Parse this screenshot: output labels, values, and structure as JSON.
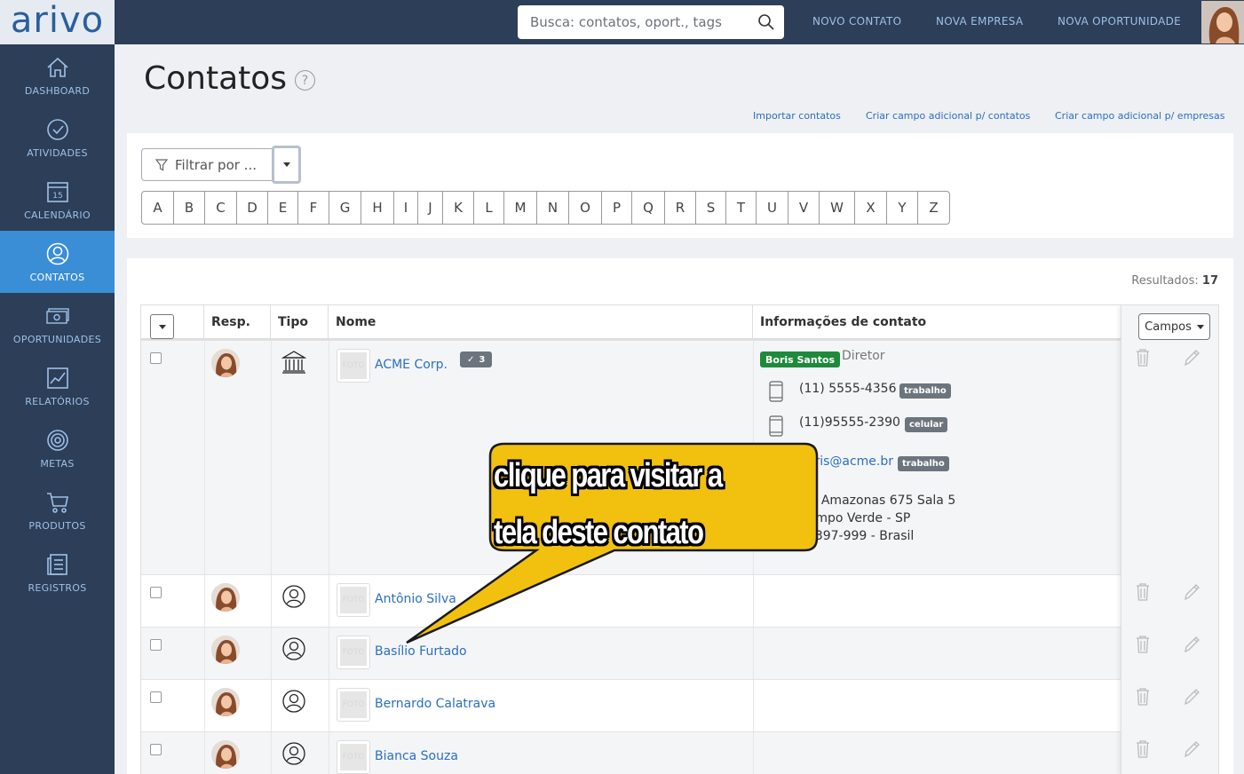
{
  "app": {
    "logo": "arivo"
  },
  "sidebar": {
    "items": [
      {
        "label": "DASHBOARD",
        "icon": "home-icon"
      },
      {
        "label": "ATIVIDADES",
        "icon": "check-circle-icon"
      },
      {
        "label": "CALENDÁRIO",
        "icon": "calendar-icon",
        "day": "15"
      },
      {
        "label": "CONTATOS",
        "icon": "contact-icon",
        "active": true
      },
      {
        "label": "OPORTUNIDADES",
        "icon": "money-icon"
      },
      {
        "label": "RELATÓRIOS",
        "icon": "chart-icon"
      },
      {
        "label": "METAS",
        "icon": "target-icon"
      },
      {
        "label": "PRODUTOS",
        "icon": "cart-icon"
      },
      {
        "label": "REGISTROS",
        "icon": "records-icon"
      }
    ]
  },
  "topbar": {
    "search_placeholder": "Busca: contatos, oport., tags",
    "links": [
      "NOVO CONTATO",
      "NOVA EMPRESA",
      "NOVA OPORTUNIDADE"
    ]
  },
  "page": {
    "title": "Contatos",
    "help": "?",
    "sublinks": [
      "Importar contatos",
      "Criar campo adicional p/ contatos",
      "Criar campo adicional p/ empresas"
    ]
  },
  "filter": {
    "label": "Filtrar por ...",
    "letters": [
      "A",
      "B",
      "C",
      "D",
      "E",
      "F",
      "G",
      "H",
      "I",
      "J",
      "K",
      "L",
      "M",
      "N",
      "O",
      "P",
      "Q",
      "R",
      "S",
      "T",
      "U",
      "V",
      "W",
      "X",
      "Y",
      "Z"
    ]
  },
  "results": {
    "label": "Resultados:",
    "count": "17"
  },
  "table": {
    "headers": {
      "resp": "Resp.",
      "tipo": "Tipo",
      "nome": "Nome",
      "info": "Informações de contato"
    },
    "campos_label": "Campos",
    "foto_placeholder": "FOTO",
    "rows": [
      {
        "name": "ACME Corp.",
        "type": "company",
        "badge": "3",
        "info": {
          "person": "Boris Santos",
          "role": "Diretor",
          "phones": [
            {
              "number": "(11) 5555-4356",
              "tag": "trabalho"
            },
            {
              "number": "(11)95555-2390",
              "tag": "celular"
            }
          ],
          "email": "boris@acme.br",
          "email_tag": "trabalho",
          "address": [
            "Av. Amazonas 675 Sala 5",
            "Campo Verde - SP",
            "01397-999 - Brasil"
          ]
        }
      },
      {
        "name": "Antônio Silva",
        "type": "person"
      },
      {
        "name": "Basílio Furtado",
        "type": "person"
      },
      {
        "name": "Bernardo Calatrava",
        "type": "person"
      },
      {
        "name": "Bianca Souza",
        "type": "person"
      }
    ]
  },
  "callout": {
    "lines": [
      "clique para visitar a",
      "tela deste contato"
    ],
    "fill": "#f2c10f"
  },
  "colors": {
    "sidebar": "#2c3e58",
    "active": "#3a8ed6",
    "link": "#2a6fc4",
    "green": "#1e8a3c"
  }
}
